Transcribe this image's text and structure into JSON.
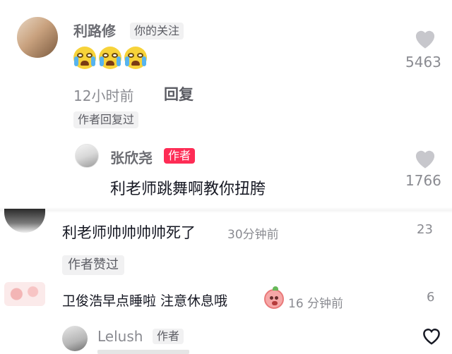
{
  "comment1": {
    "username": "利路修",
    "relation_tag": "你的关注",
    "emojis": [
      "crying-laughing",
      "crying-laughing",
      "crying-laughing"
    ],
    "time": "12小时前",
    "reply_label": "回复",
    "author_replied_tag": "作者回复过",
    "like_count": "5463"
  },
  "reply1": {
    "username": "张欣尧",
    "author_badge": "作者",
    "text": "利老师跳舞啊教你扭胯",
    "like_count": "1766"
  },
  "comment2": {
    "text": "利老师帅帅帅帅死了",
    "time": "30分钟前",
    "like_count": "23",
    "author_liked_tag": "作者赞过"
  },
  "comment3": {
    "text": "卫俊浩早点睡啦 注意休息哦",
    "time": "16 分钟前",
    "like_count": "6"
  },
  "comment4": {
    "username": "Lelush",
    "author_badge": "作者"
  },
  "colors": {
    "accent": "#fe2c55",
    "heart": "#c7c7cc",
    "text": "#161823",
    "muted": "#8a8b91"
  }
}
